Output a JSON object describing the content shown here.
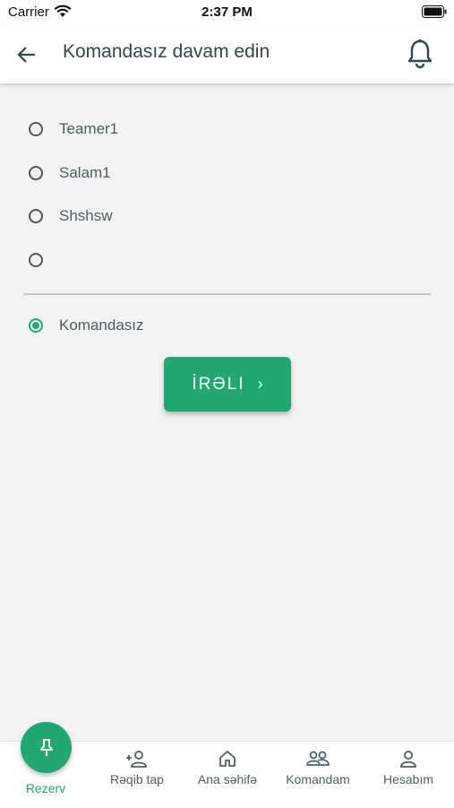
{
  "status_bar": {
    "carrier": "Carrier",
    "time": "2:37 PM"
  },
  "header": {
    "title": "Komandasız davam edin",
    "back_icon": "arrow-left-icon",
    "bell_icon": "bell-icon"
  },
  "options": [
    {
      "label": "Teamer1",
      "checked": false
    },
    {
      "label": "Salam1",
      "checked": false
    },
    {
      "label": "Shshsw",
      "checked": false
    },
    {
      "label": "",
      "checked": false
    }
  ],
  "no_team_option": {
    "label": "Komandasız",
    "checked": true
  },
  "next_button": {
    "label": "İRƏLI",
    "chevron": "›"
  },
  "bottom_nav": {
    "fab": {
      "label": "Rezerv",
      "icon": "pin-icon"
    },
    "items": [
      {
        "label": "Rəqib tap",
        "icon": "add-person-icon"
      },
      {
        "label": "Ana səhifə",
        "icon": "home-icon"
      },
      {
        "label": "Komandam",
        "icon": "group-icon"
      },
      {
        "label": "Hesabım",
        "icon": "person-icon"
      }
    ]
  },
  "colors": {
    "accent": "#22a773",
    "background": "#f3f3f3",
    "text": "#4a5d66"
  }
}
